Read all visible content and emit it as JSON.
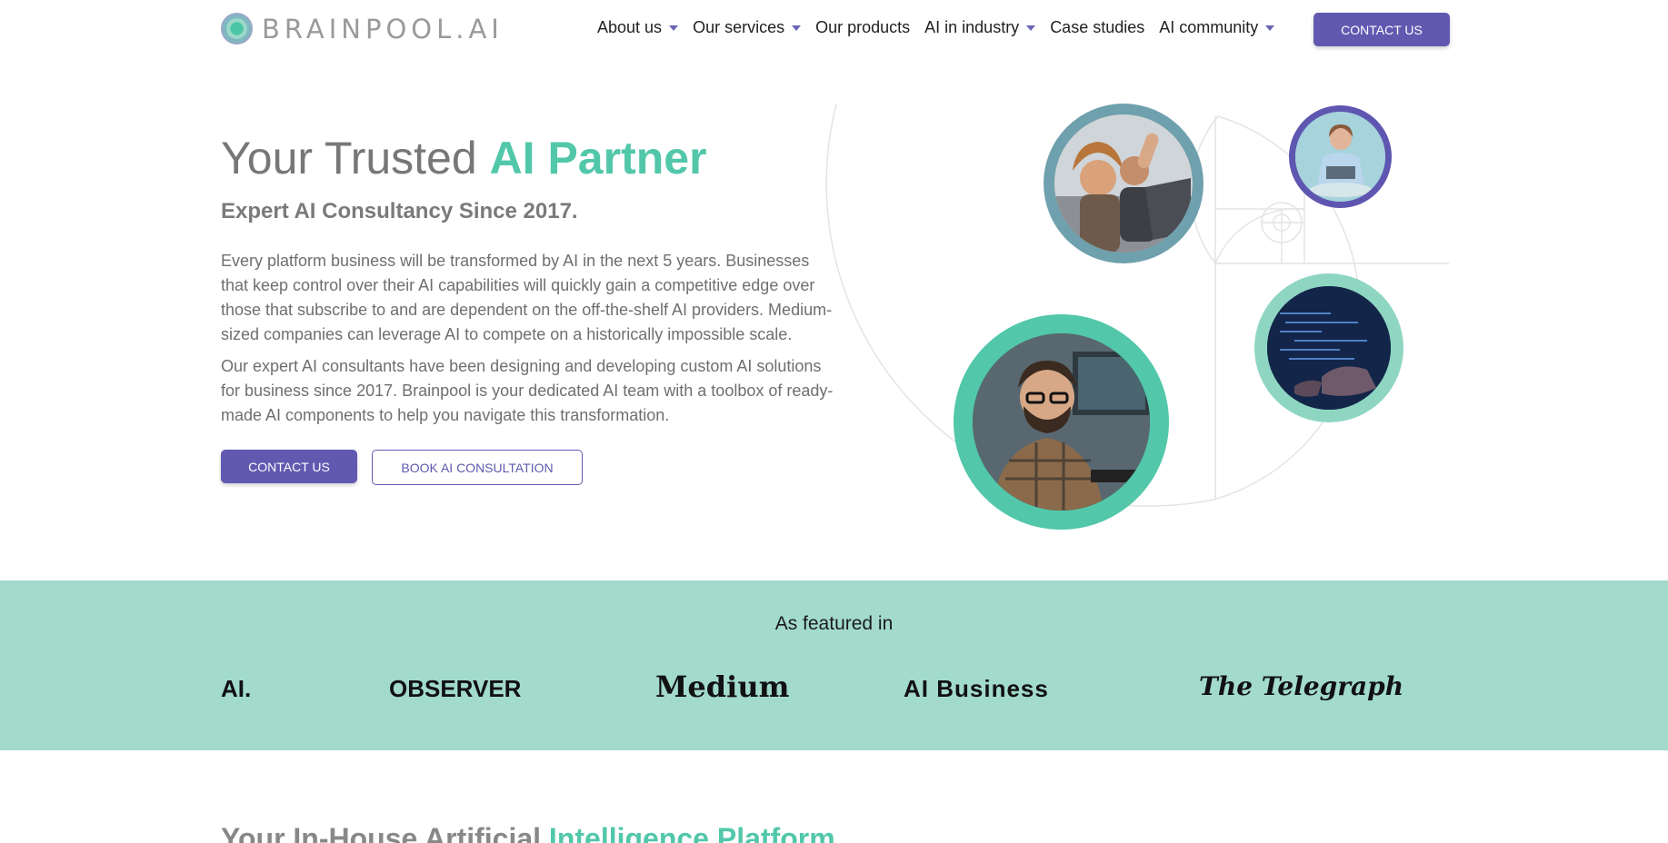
{
  "brand": {
    "name": "BRAINPOOL.AI"
  },
  "nav": {
    "items": [
      {
        "label": "About us",
        "dropdown": true
      },
      {
        "label": "Our services",
        "dropdown": true
      },
      {
        "label": "Our products",
        "dropdown": false
      },
      {
        "label": "AI in industry",
        "dropdown": true
      },
      {
        "label": "Case studies",
        "dropdown": false
      },
      {
        "label": "AI community",
        "dropdown": true
      }
    ],
    "cta": "CONTACT US"
  },
  "hero": {
    "title_main": "Your Trusted ",
    "title_accent": "AI Partner",
    "subtitle": "Expert AI Consultancy Since 2017.",
    "paragraph1": "Every platform business will be transformed by AI in the next 5 years. Businesses that keep control over their AI capabilities will quickly gain a competitive edge over those that subscribe to and are dependent on the off-the-shelf AI providers. Medium-sized companies can leverage AI to compete on a historically impossible scale.",
    "paragraph2": "Our expert AI consultants have been designing and developing custom AI solutions for business since 2017. Brainpool is your dedicated AI team with a toolbox of ready-made AI components to help you navigate this transformation.",
    "primary_button": "CONTACT US",
    "secondary_button": "BOOK AI CONSULTATION"
  },
  "featured": {
    "title": "As featured in",
    "logos": [
      "AI.",
      "OBSERVER",
      "Medium",
      "AI Business",
      "The Telegraph"
    ]
  },
  "next_section": {
    "title_main": "Your In-House Artificial ",
    "title_accent": "Intelligence Platform"
  },
  "colors": {
    "brand_purple": "#6159b0",
    "accent_teal": "#52c7aa",
    "band_green": "#a2dacc"
  }
}
